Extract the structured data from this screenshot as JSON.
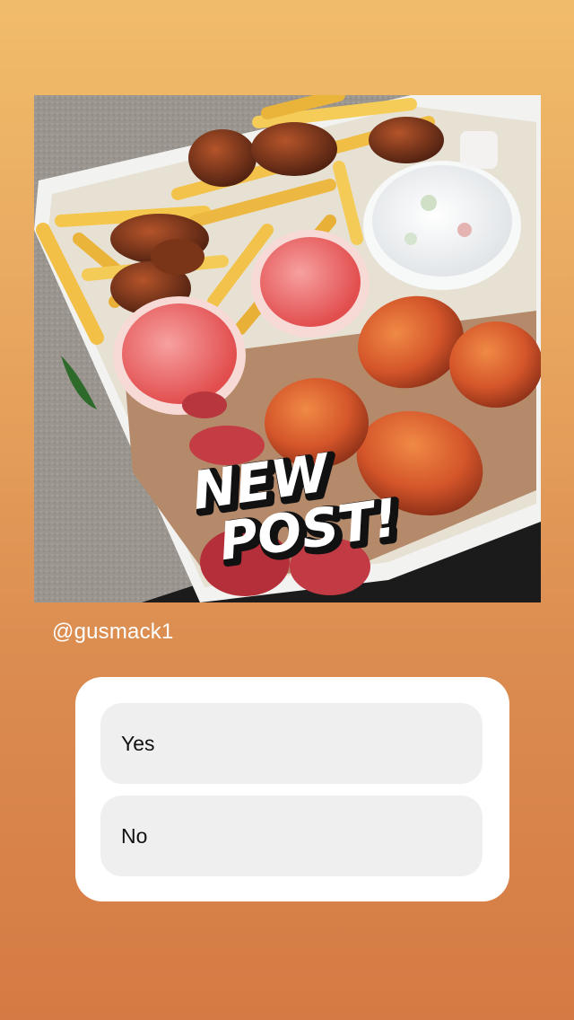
{
  "story": {
    "background_top": "#f0bc6a",
    "background_bottom": "#d57a44"
  },
  "post": {
    "image_description_icon": "food-platter-photo",
    "sticker_line1": "NEW",
    "sticker_line2": "POST!",
    "username": "@gusmack1"
  },
  "poll": {
    "options": [
      {
        "label": "Yes"
      },
      {
        "label": "No"
      }
    ]
  }
}
